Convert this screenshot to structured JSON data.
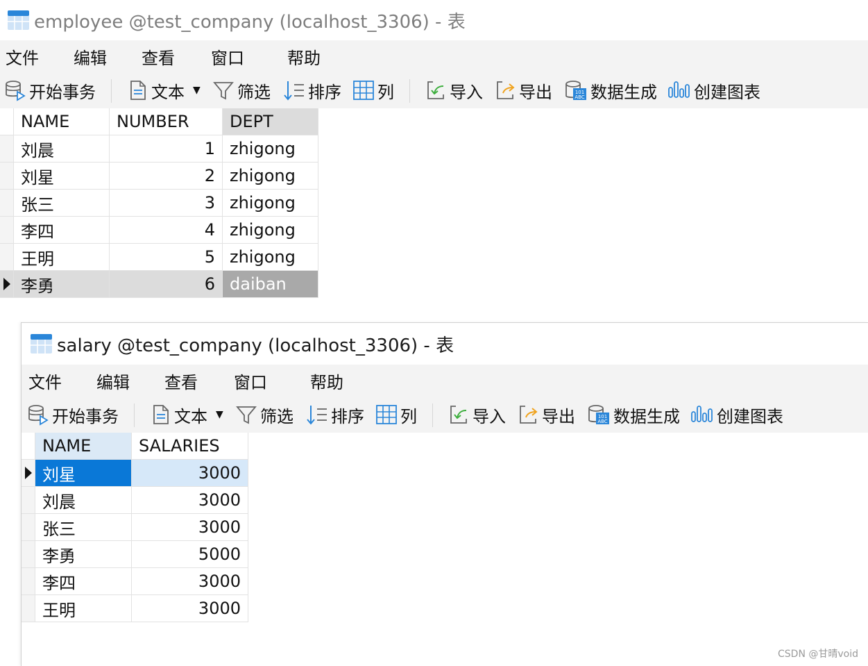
{
  "employee_window": {
    "title": "employee @test_company (localhost_3306) - 表",
    "menu": [
      "文件",
      "编辑",
      "查看",
      "窗口",
      "帮助"
    ],
    "toolbar": {
      "begin_transaction": "开始事务",
      "text": "文本",
      "filter": "筛选",
      "sort": "排序",
      "columns": "列",
      "import": "导入",
      "export": "导出",
      "data_generation": "数据生成",
      "create_chart": "创建图表"
    },
    "table": {
      "columns": [
        "NAME",
        "NUMBER",
        "DEPT"
      ],
      "rows": [
        [
          "刘晨",
          "1",
          "zhigong"
        ],
        [
          "刘星",
          "2",
          "zhigong"
        ],
        [
          "张三",
          "3",
          "zhigong"
        ],
        [
          "李四",
          "4",
          "zhigong"
        ],
        [
          "王明",
          "5",
          "zhigong"
        ],
        [
          "李勇",
          "6",
          "daiban"
        ]
      ],
      "selected_row": 5
    }
  },
  "salary_window": {
    "title": "salary @test_company (localhost_3306) - 表",
    "menu": [
      "文件",
      "编辑",
      "查看",
      "窗口",
      "帮助"
    ],
    "toolbar": {
      "begin_transaction": "开始事务",
      "text": "文本",
      "filter": "筛选",
      "sort": "排序",
      "columns": "列",
      "import": "导入",
      "export": "导出",
      "data_generation": "数据生成",
      "create_chart": "创建图表"
    },
    "table": {
      "columns": [
        "NAME",
        "SALARIES"
      ],
      "rows": [
        [
          "刘星",
          "3000"
        ],
        [
          "刘晨",
          "3000"
        ],
        [
          "张三",
          "3000"
        ],
        [
          "李勇",
          "5000"
        ],
        [
          "李四",
          "3000"
        ],
        [
          "王明",
          "3000"
        ]
      ],
      "selected_row": 0
    }
  },
  "watermark": "CSDN @甘晴void",
  "colors": {
    "selection_blue": "#0a78d7",
    "selection_light": "#d6e8f9",
    "row_gray": "#dcdcdc",
    "cell_dark_gray": "#a9a9a9",
    "menubar_bg": "#f3f3f3"
  }
}
